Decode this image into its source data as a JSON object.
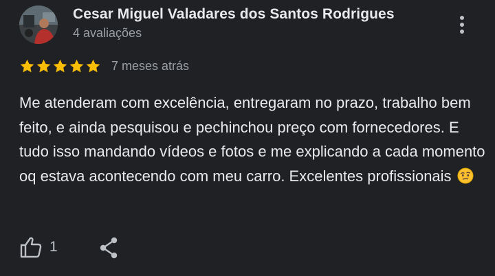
{
  "review": {
    "author_name": "Cesar Miguel Valadares dos Santos Rodrigues",
    "review_count": "4 avaliações",
    "rating": 5,
    "date": "7 meses atrás",
    "text": "Me atenderam com excelência, entregaram no prazo, trabalho bem feito, e ainda pesquisou e pechinchou preço com fornecedores. E tudo isso mandando vídeos e fotos e me explicando a cada momento oq estava acontecendo com meu carro. Excelentes profissionais",
    "like_count": "1"
  },
  "icons": {
    "more": "more-vert-icon",
    "star": "star-icon",
    "emoji": "face-with-monocle-like-emoji-icon",
    "like": "thumbs-up-icon",
    "share": "share-icon"
  },
  "colors": {
    "background": "#202124",
    "star": "#fbbc04",
    "text": "#e8eaed",
    "secondary_text": "#9aa0a6",
    "icon": "#bdc1c6"
  }
}
